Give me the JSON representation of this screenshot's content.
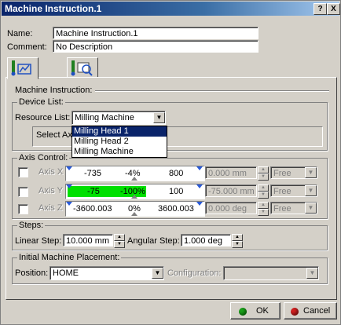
{
  "window": {
    "title": "Machine Instruction.1",
    "help_label": "?",
    "close_label": "X"
  },
  "form": {
    "name_label": "Name:",
    "name_value": "Machine Instruction.1",
    "comment_label": "Comment:",
    "comment_value": "No Description"
  },
  "tabs": [
    {
      "icon": "machine-instruction-icon"
    },
    {
      "icon": "machine-inspect-icon"
    }
  ],
  "machine_instruction_group": "Machine Instruction:",
  "device_list": {
    "legend": "Device List:",
    "resource_label": "Resource List:",
    "resource_value": "Milling Machine",
    "options": [
      "Milling Head 1",
      "Milling Head 2",
      "Milling Machine"
    ],
    "highlighted_option": "Milling Head 1",
    "select_text": "Select Ax"
  },
  "axis_control": {
    "legend": "Axis Control:",
    "axes": [
      {
        "label": "Axis X",
        "min": "-735",
        "pct": "-4%",
        "max": "800",
        "value": "0.000 mm",
        "mode": "Free",
        "level": 0
      },
      {
        "label": "Axis Y",
        "min": "-75",
        "pct": "-100%",
        "max": "100",
        "value": "-75.000 mm",
        "mode": "Free",
        "level": 1
      },
      {
        "label": "Axis Z",
        "min": "-3600.003",
        "pct": "0%",
        "max": "3600.003",
        "value": "0.000 deg",
        "mode": "Free",
        "level": 0
      }
    ]
  },
  "steps": {
    "legend": "Steps:",
    "linear_label": "Linear Step:",
    "linear_value": "10.000 mm",
    "angular_label": "Angular Step:",
    "angular_value": "1.000 deg"
  },
  "placement": {
    "legend": "Initial Machine Placement:",
    "position_label": "Position:",
    "position_value": "HOME",
    "configuration_label": "Configuration:",
    "configuration_value": ""
  },
  "buttons": {
    "ok": "OK",
    "cancel": "Cancel"
  },
  "colors": {
    "title_start": "#0a246a",
    "slider_fill": "#00e000",
    "ok_dot": "#1aa01a",
    "cancel_dot": "#d02020"
  }
}
